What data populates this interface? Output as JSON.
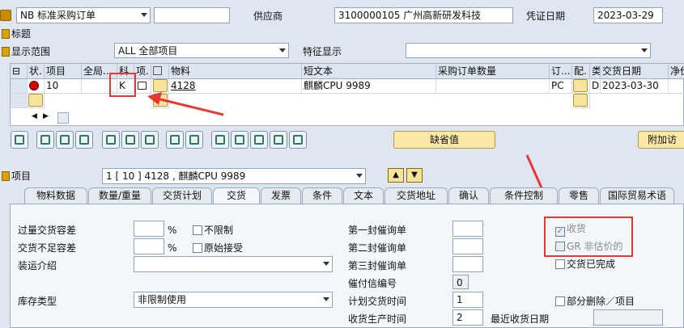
{
  "header": {
    "doc_type_value": "NB 标准采购订单",
    "vendor_label": "供应商",
    "vendor_value": "3100000105 广州高新研发科技",
    "doc_date_label": "凭证日期",
    "doc_date_value": "2023-03-29"
  },
  "title_section": {
    "label": "标题"
  },
  "display": {
    "scope_label": "显示范围",
    "scope_value": "ALL 全部项目",
    "feature_label": "特征显示"
  },
  "grid": {
    "headers": [
      "状.",
      "项目",
      "全局...",
      "科",
      "项.",
      "物料",
      "短文本",
      "采购订单数量",
      "订...",
      "配.",
      "类",
      "交货日期",
      "净价"
    ],
    "row1": {
      "item": "10",
      "acct": "K",
      "material": "4128",
      "short_text": "麒麟CPU 9989",
      "unit": "PC",
      "cat": "D",
      "delivery_date": "2023-03-30"
    }
  },
  "toolbar": {
    "default_values_label": "缺省值",
    "additional_label": "附加访"
  },
  "item_section": {
    "label": "项目",
    "selected_value": "1 [ 10 ] 4128 , 麒麟CPU 9989"
  },
  "tabs": [
    "物料数据",
    "数量/重量",
    "交货计划",
    "交货",
    "发票",
    "条件",
    "文本",
    "交货地址",
    "确认",
    "条件控制",
    "零售",
    "国际贸易术语"
  ],
  "active_tab": "交货",
  "delivery": {
    "overdelivery_label": "过量交货容差",
    "underdelivery_label": "交货不足容差",
    "percent": "%",
    "unlimited_label": "不限制",
    "original_accept_label": "原始接受",
    "shipping_instr_label": "装运介绍",
    "stock_type_label": "库存类型",
    "stock_type_value": "非限制使用",
    "reminder1_label": "第一封催询单",
    "reminder2_label": "第二封催询单",
    "reminder3_label": "第三封催询单",
    "reminder_no_label": "催付信编号",
    "reminder_no_value": "0",
    "plan_delivery_label": "计划交货时间",
    "plan_delivery_value": "1",
    "gr_processing_label": "收货生产时间",
    "gr_processing_value": "2",
    "last_delivery_date_label": "最近收货日期",
    "goods_receipt_label": "收货",
    "gr_nonvaluated_label": "GR 非估价的",
    "delivery_completed_label": "交货已完成",
    "partial_delete_label": "部分删除／项目"
  },
  "colors": {
    "highlight_red": "#e53935",
    "background": "#dfe6ef",
    "button_yellow": "#fce9a8"
  }
}
